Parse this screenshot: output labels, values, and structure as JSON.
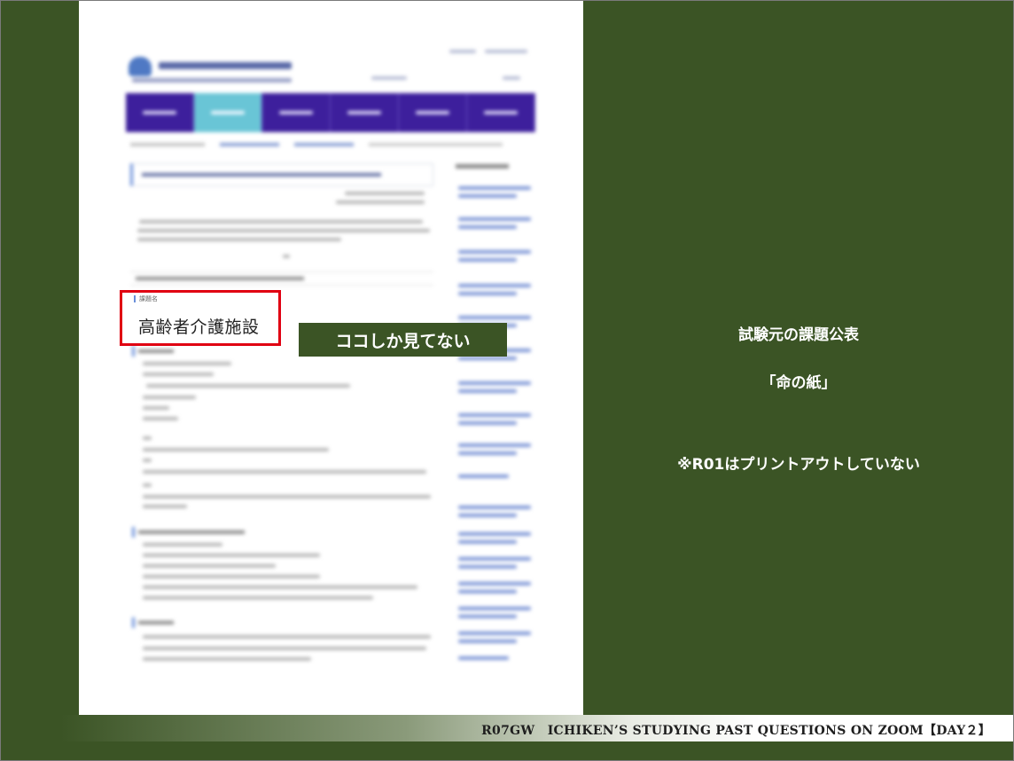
{
  "callout": {
    "label": "ココしか見てない"
  },
  "highlight": {
    "label": "課題名",
    "value": "高齢者介護施設"
  },
  "notes": {
    "line1": "試験元の課題公表",
    "line2": "「命の紙」",
    "line3": "※R01はプリントアウトしていない"
  },
  "footer": {
    "text": "R07GW　ICHIKEN’S STUDYING PAST QUESTIONS ON ZOOM【DAY２】"
  },
  "colors": {
    "background": "#3b5425",
    "highlight_border": "#e00012",
    "nav": "#3d1f9c",
    "nav_active": "#69c5d6"
  }
}
